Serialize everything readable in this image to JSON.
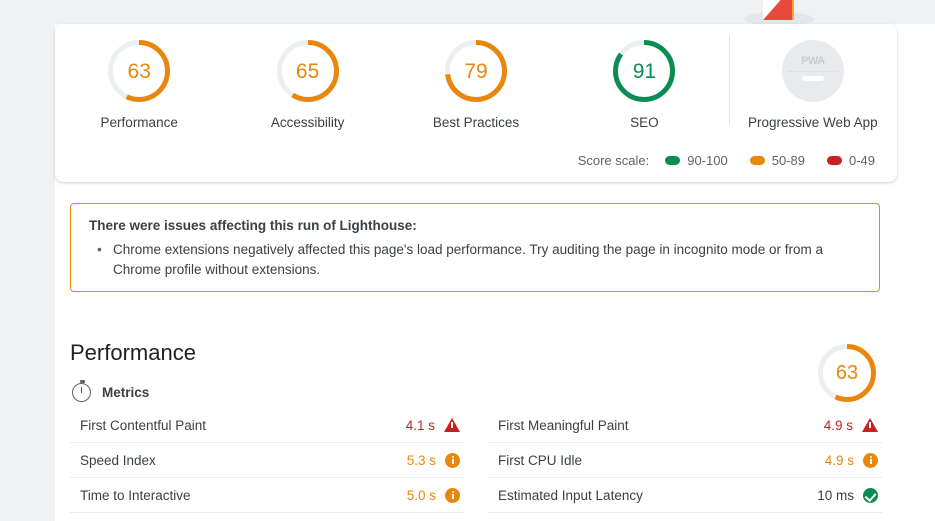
{
  "scores_card": {
    "gauges": [
      {
        "score": "63",
        "label": "Performance",
        "color": "#e8870b",
        "pct": 63,
        "type": "gauge"
      },
      {
        "score": "65",
        "label": "Accessibility",
        "color": "#e8870b",
        "pct": 65,
        "type": "gauge"
      },
      {
        "score": "79",
        "label": "Best Practices",
        "color": "#e8870b",
        "pct": 79,
        "type": "gauge"
      },
      {
        "score": "91",
        "label": "SEO",
        "color": "#0c8c52",
        "pct": 91,
        "type": "gauge"
      },
      {
        "score": "PWA",
        "label": "Progressive Web App",
        "color": "#c7ccd1",
        "pct": 0,
        "type": "badge"
      }
    ],
    "score_scale": {
      "title": "Score scale:",
      "items": [
        {
          "range": "90-100",
          "color": "#0c8c52"
        },
        {
          "range": "50-89",
          "color": "#e8870b"
        },
        {
          "range": "0-49",
          "color": "#c7221f"
        }
      ]
    }
  },
  "warning": {
    "title": "There were issues affecting this run of Lighthouse:",
    "items": [
      "Chrome extensions negatively affected this page's load performance. Try auditing the page in incognito mode or from a Chrome profile without extensions."
    ],
    "border_color": "#e8870b"
  },
  "performance": {
    "title": "Performance",
    "gauge": {
      "score": "63",
      "color": "#e8870b",
      "pct": 63
    },
    "metrics_header": {
      "label": "Metrics",
      "icon": "stopwatch-icon"
    },
    "columns": [
      {
        "rows": [
          {
            "name": "First Contentful Paint",
            "value": "4.1 s",
            "status": "red",
            "icon": "warning-triangle-icon"
          },
          {
            "name": "Speed Index",
            "value": "5.3 s",
            "status": "orange",
            "icon": "info-circle-icon"
          },
          {
            "name": "Time to Interactive",
            "value": "5.0 s",
            "status": "orange",
            "icon": "info-circle-icon"
          }
        ]
      },
      {
        "rows": [
          {
            "name": "First Meaningful Paint",
            "value": "4.9 s",
            "status": "red",
            "icon": "warning-triangle-icon"
          },
          {
            "name": "First CPU Idle",
            "value": "4.9 s",
            "status": "orange",
            "icon": "info-circle-icon"
          },
          {
            "name": "Estimated Input Latency",
            "value": "10 ms",
            "status": "green",
            "icon": "pass-check-icon"
          }
        ]
      }
    ]
  },
  "colors": {
    "page_background": "#eff1f3",
    "sheet": "#ffffff",
    "orange": "#e8870b",
    "green": "#0c8c52",
    "red": "#c7221f",
    "text": "#3c4043",
    "divider": "#e8eaed"
  }
}
